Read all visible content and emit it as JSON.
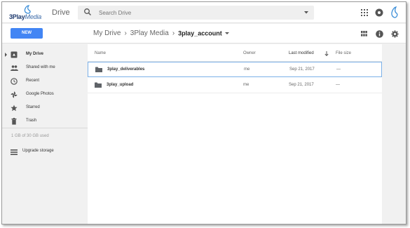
{
  "app": {
    "logo_text_a": "3Play",
    "logo_text_b": "Media",
    "product_name": "Drive"
  },
  "search": {
    "placeholder": "Search Drive"
  },
  "toolbar": {
    "new_label": "NEW"
  },
  "breadcrumb": {
    "root": "My Drive",
    "middle": "3Play Media",
    "current": "3play_account"
  },
  "sidebar": {
    "items": [
      {
        "label": "My Drive",
        "icon": "drive-icon"
      },
      {
        "label": "Shared with me",
        "icon": "people-icon"
      },
      {
        "label": "Recent",
        "icon": "clock-icon"
      },
      {
        "label": "Google Photos",
        "icon": "pinwheel-icon"
      },
      {
        "label": "Starred",
        "icon": "star-icon"
      },
      {
        "label": "Trash",
        "icon": "trash-icon"
      }
    ],
    "storage_text": "1 GB of 30 GB used",
    "upgrade_label": "Upgrade storage"
  },
  "files": {
    "headers": {
      "name": "Name",
      "owner": "Owner",
      "last_modified": "Last modified",
      "file_size": "File size"
    },
    "rows": [
      {
        "name": "3play_deliverables",
        "owner": "me",
        "modified": "Sep 21, 2017",
        "size": "—"
      },
      {
        "name": "3play_upload",
        "owner": "me",
        "modified": "Sep 21, 2017",
        "size": "—"
      }
    ]
  },
  "colors": {
    "accent": "#4285f4",
    "selection_border": "#7bb0e8"
  }
}
